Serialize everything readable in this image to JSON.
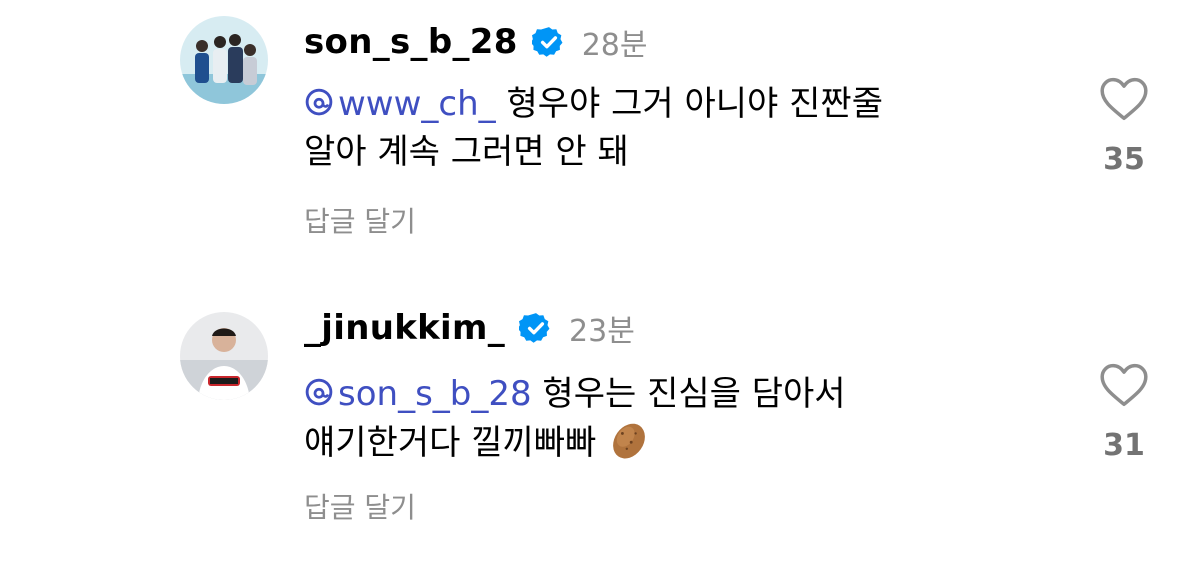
{
  "comments": [
    {
      "username": "son_s_b_28",
      "time": "28분",
      "mention": "www_ch_",
      "text_line1": " 형우야 그거 아니야 진짠줄",
      "text_line2": "알아 계속 그러면 안 돼",
      "reply_label": "답글 달기",
      "likes": "35"
    },
    {
      "username": "_jinukkim_",
      "time": "23분",
      "mention": "son_s_b_28",
      "text_line1": " 형우는 진심을 담아서",
      "text_line2": "얘기한거다 낄끼빠빠",
      "emoji": "potato",
      "reply_label": "답글 달기",
      "likes": "31"
    }
  ],
  "colors": {
    "mention": "#3f4fc1",
    "verified": "#0095f6",
    "secondary_text": "#8e8e8e"
  }
}
